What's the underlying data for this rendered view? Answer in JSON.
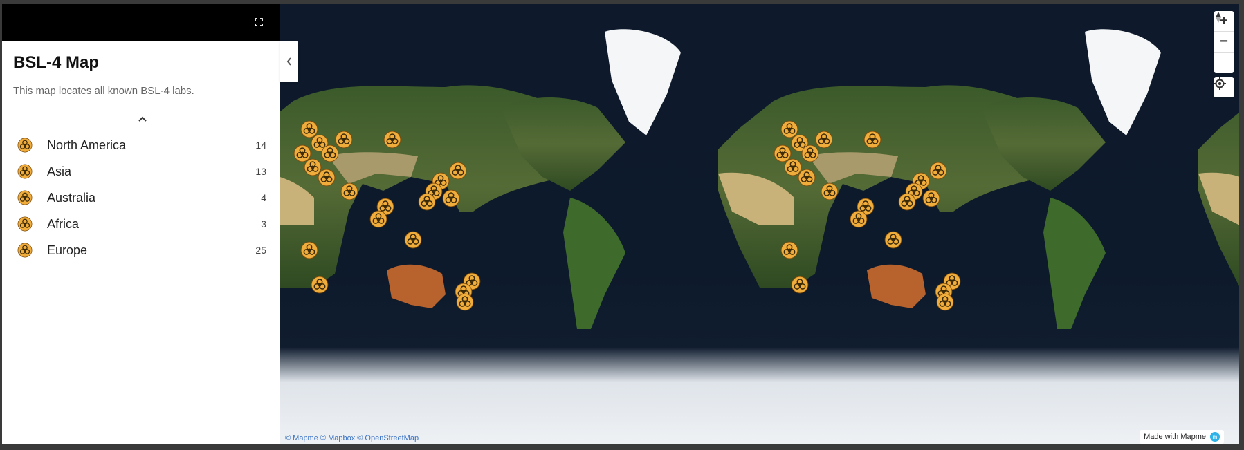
{
  "sidebar": {
    "title": "BSL-4 Map",
    "description": "This map locates all known BSL-4 labs.",
    "categories": [
      {
        "name": "North America",
        "count": "14"
      },
      {
        "name": "Asia",
        "count": "13"
      },
      {
        "name": "Australia",
        "count": "4"
      },
      {
        "name": "Africa",
        "count": "3"
      },
      {
        "name": "Europe",
        "count": "25"
      }
    ]
  },
  "controls": {
    "zoom_in": "+",
    "zoom_out": "−"
  },
  "attribution": {
    "mapme": "© Mapme",
    "mapbox": "© Mapbox",
    "osm": "© OpenStreetMap"
  },
  "badge": {
    "label": "Made with Mapme"
  },
  "icons": {
    "marker": "biohazard-icon",
    "fullscreen": "fullscreen-icon",
    "collapse": "chevron-left-icon",
    "expand": "chevron-up-icon",
    "compass": "compass-icon",
    "locate": "locate-icon"
  },
  "colors": {
    "marker_fill": "#f0ad3c",
    "marker_stroke": "#7a4a0c",
    "ocean": "#0d1a2b",
    "accent": "#2fb3e8"
  }
}
